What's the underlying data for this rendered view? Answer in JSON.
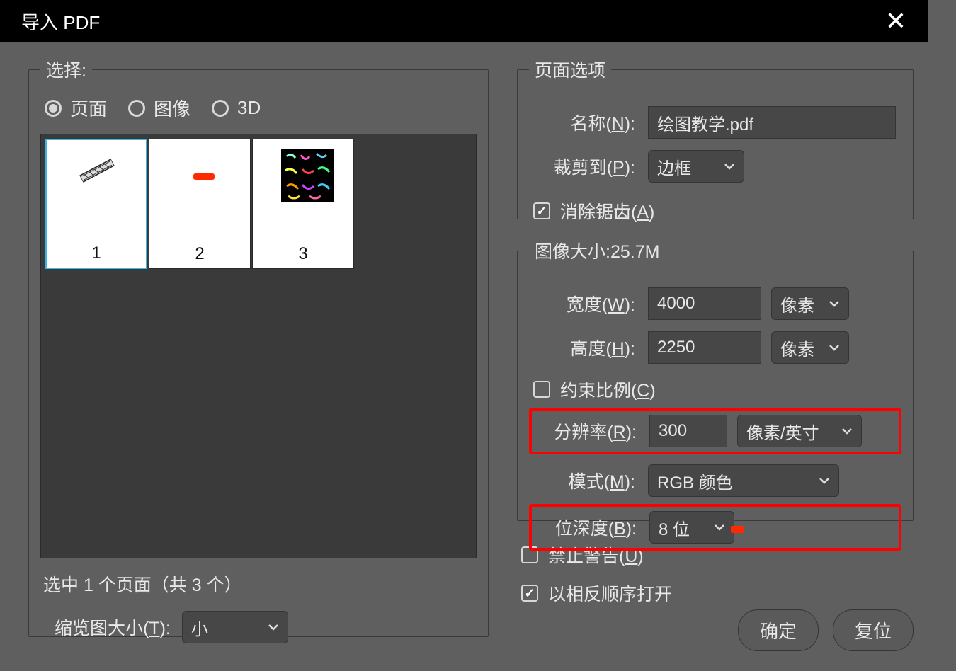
{
  "title": "导入 PDF",
  "close_icon": "✕",
  "left": {
    "legend": "选择:",
    "radios": {
      "pages": "页面",
      "images": "图像",
      "three_d": "3D"
    },
    "thumbs": [
      {
        "num": "1",
        "selected": true
      },
      {
        "num": "2",
        "selected": false
      },
      {
        "num": "3",
        "selected": false
      }
    ],
    "selection_status": "选中 1 个页面（共 3 个）",
    "thumb_size_label": "缩览图大小(T):",
    "thumb_size_value": "小"
  },
  "right": {
    "page_options_legend": "页面选项",
    "name_label": "名称(N):",
    "name_value": "绘图教学.pdf",
    "crop_label": "裁剪到(P):",
    "crop_value": "边框",
    "antialias_label": "消除锯齿(A)",
    "image_size_legend": "图像大小:25.7M",
    "width_label": "宽度(W):",
    "width_value": "4000",
    "width_unit": "像素",
    "height_label": "高度(H):",
    "height_value": "2250",
    "height_unit": "像素",
    "constrain_label": "约束比例(C)",
    "resolution_label": "分辨率(R):",
    "resolution_value": "300",
    "resolution_unit": "像素/英寸",
    "mode_label": "模式(M):",
    "mode_value": "RGB 颜色",
    "bitdepth_label": "位深度(B):",
    "bitdepth_value": "8 位",
    "suppress_warn_label": "禁止警告(U)",
    "reverse_order_label": "以相反顺序打开",
    "ok_label": "确定",
    "reset_label": "复位"
  }
}
